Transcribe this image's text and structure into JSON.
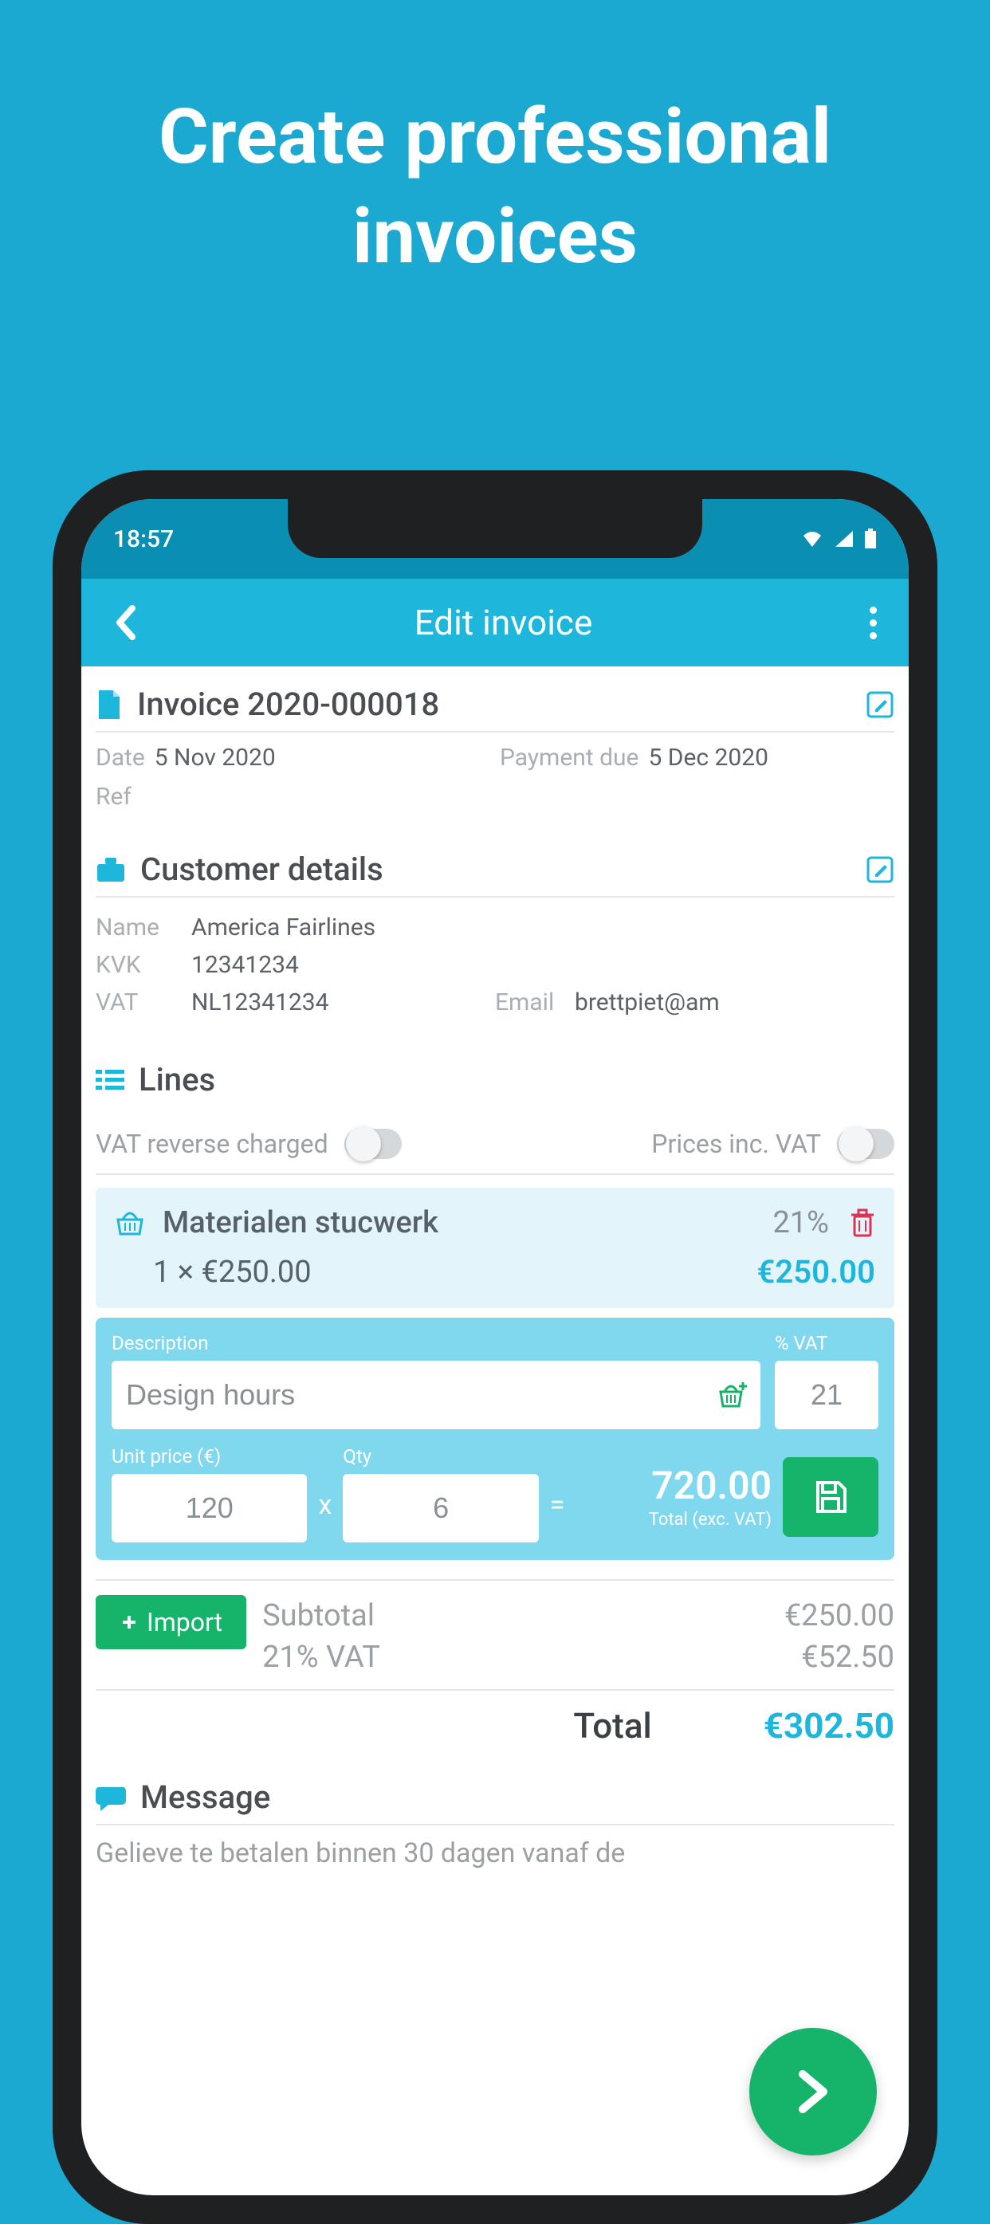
{
  "hero": "Create professional invoices",
  "status": {
    "time": "18:57"
  },
  "header": {
    "title": "Edit invoice"
  },
  "invoice": {
    "title": "Invoice 2020-000018",
    "date_label": "Date",
    "date_value": "5 Nov 2020",
    "due_label": "Payment due",
    "due_value": "5 Dec 2020",
    "ref_label": "Ref"
  },
  "customer": {
    "section_title": "Customer details",
    "name_label": "Name",
    "name_value": "America Fairlines",
    "kvk_label": "KVK",
    "kvk_value": "12341234",
    "vat_label": "VAT",
    "vat_value": "NL12341234",
    "email_label": "Email",
    "email_value": "brettpiet@am"
  },
  "lines": {
    "section_title": "Lines",
    "vat_reverse_label": "VAT reverse charged",
    "prices_inc_label": "Prices inc. VAT",
    "item": {
      "title": "Materialen stucwerk",
      "vat_rate": "21%",
      "qty_price": "1 ×   €250.00",
      "total": "€250.00"
    },
    "edit": {
      "desc_label": "Description",
      "desc_value": "Design hours",
      "vat_label": "% VAT",
      "vat_value": "21",
      "unit_label": "Unit price  (€)",
      "unit_value": "120",
      "qty_label": "Qty",
      "qty_value": "6",
      "mult": "x",
      "eq": "=",
      "total": "720.00",
      "total_hint": "Total (exc. VAT)"
    }
  },
  "summary": {
    "import_label": "Import",
    "subtotal_label": "Subtotal",
    "subtotal_value": "€250.00",
    "vat_label": "21% VAT",
    "vat_value": "€52.50",
    "total_label": "Total",
    "total_value": "€302.50"
  },
  "message": {
    "section_title": "Message",
    "body": "Gelieve te betalen binnen 30 dagen vanaf de"
  }
}
